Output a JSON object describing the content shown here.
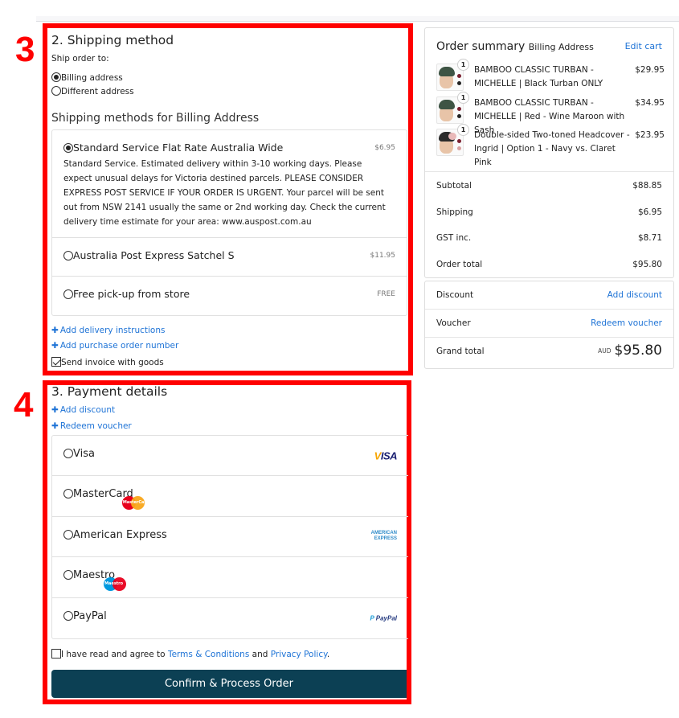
{
  "annotations": {
    "shipping_marker": "3",
    "payment_marker": "4"
  },
  "shipping": {
    "title": "2. Shipping method",
    "ship_to_label": "Ship order to:",
    "address_options": [
      {
        "label": "Billing address",
        "selected": true
      },
      {
        "label": "Different address",
        "selected": false
      }
    ],
    "methods_title": "Shipping methods for Billing Address",
    "methods": [
      {
        "name": "Standard Service Flat Rate Australia Wide",
        "price": "$6.95",
        "selected": true,
        "description": "Standard Service. Estimated delivery within 3-10 working days. Please expect unusual delays for Victoria destined parcels. PLEASE CONSIDER EXPRESS POST SERVICE IF YOUR ORDER IS URGENT. Your parcel will be sent out from NSW 2141 usually the same or 2nd working day. Check the current delivery time estimate for your area: www.auspost.com.au"
      },
      {
        "name": "Australia Post Express Satchel S",
        "price": "$11.95",
        "selected": false
      },
      {
        "name": "Free pick-up from store",
        "price": "FREE",
        "selected": false
      }
    ],
    "add_delivery_instructions": "Add delivery instructions",
    "add_purchase_order": "Add purchase order number",
    "send_invoice_label": "Send invoice with goods",
    "send_invoice_checked": true
  },
  "payment": {
    "title": "3. Payment details",
    "add_discount": "Add discount",
    "redeem_voucher": "Redeem voucher",
    "methods": [
      {
        "name": "Visa",
        "logo": "visa-logo",
        "logo_text": "VISA"
      },
      {
        "name": "MasterCard",
        "logo": "mastercard-logo",
        "logo_text": "MasterCard"
      },
      {
        "name": "American Express",
        "logo": "amex-logo",
        "logo_text": "AMERICAN EXPRESS"
      },
      {
        "name": "Maestro",
        "logo": "maestro-logo",
        "logo_text": "Maestro"
      },
      {
        "name": "PayPal",
        "logo": "paypal-logo",
        "logo_text": "PayPal"
      }
    ],
    "terms_prefix": "I have read and agree to ",
    "terms_link": "Terms & Conditions",
    "terms_and": " and ",
    "privacy_link": "Privacy Policy",
    "terms_suffix": ".",
    "terms_checked": false,
    "confirm_button": "Confirm & Process Order",
    "confirm_color": "#0c4054"
  },
  "summary": {
    "title": "Order summary",
    "subtitle": "Billing Address",
    "edit_cart": "Edit cart",
    "items": [
      {
        "qty": "1",
        "name": "BAMBOO CLASSIC TURBAN - MICHELLE | Black Turban ONLY",
        "price": "$29.95"
      },
      {
        "qty": "1",
        "name": "BAMBOO CLASSIC TURBAN - MICHELLE | Red - Wine Maroon with Sash",
        "price": "$34.95"
      },
      {
        "qty": "1",
        "name": "Double-sided Two-toned Headcover - Ingrid | Option 1 - Navy vs. Claret Pink",
        "price": "$23.95"
      }
    ],
    "totals": [
      {
        "label": "Subtotal",
        "value": "$88.85"
      },
      {
        "label": "Shipping",
        "value": "$6.95"
      },
      {
        "label": "GST inc.",
        "value": "$8.71"
      },
      {
        "label": "Order total",
        "value": "$95.80"
      }
    ],
    "discount_label": "Discount",
    "discount_action": "Add discount",
    "voucher_label": "Voucher",
    "voucher_action": "Redeem voucher",
    "grand_total_label": "Grand total",
    "grand_total_currency": "AUD",
    "grand_total_value": "$95.80"
  },
  "colors": {
    "link": "#1e73d6",
    "annotation": "#ff0000",
    "button": "#0c4054"
  }
}
